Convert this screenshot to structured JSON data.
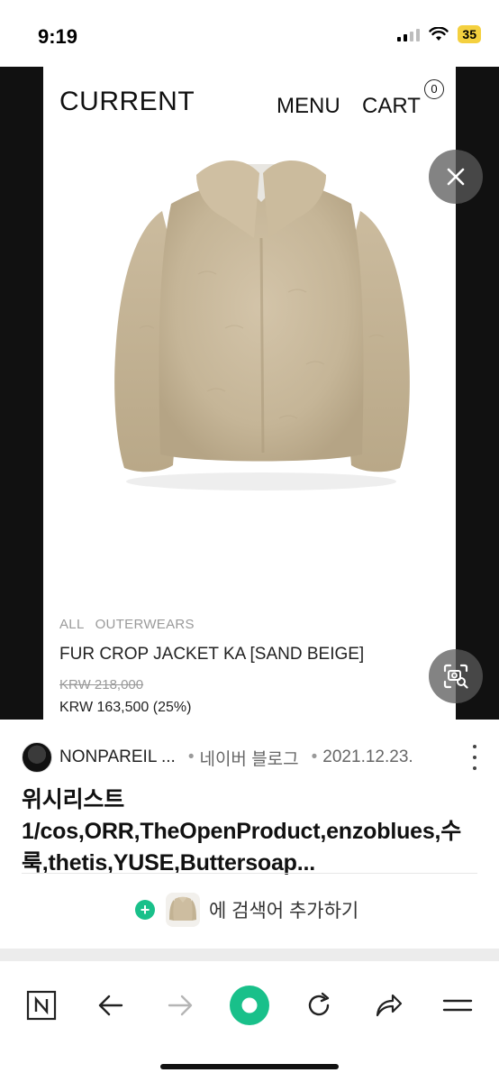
{
  "status_bar": {
    "time": "9:19",
    "battery": "35",
    "battery_color": "#f4d03f"
  },
  "viewer": {
    "site": {
      "brand": "CURRENT",
      "menu_label": "MENU",
      "cart_label": "CART",
      "cart_count": "0"
    },
    "product": {
      "breadcrumb": [
        "ALL",
        "OUTERWEARS"
      ],
      "name": "FUR CROP JACKET KA [SAND BEIGE]",
      "price_original": "KRW 218,000",
      "price_sale": "KRW 163,500 (25%)",
      "image_icon": "beige-fur-jacket"
    },
    "close_icon": "close-icon",
    "lens_icon": "image-search-icon"
  },
  "result": {
    "source_name": "NONPAREIL ...",
    "separator": "•",
    "source_type": "네이버 블로그",
    "date": "2021.12.23.",
    "title": "위시리스트1/cos,ORR,TheOpenProduct,enzoblues,수룩,thetis,YUSE,Buttersoap..."
  },
  "add_query": {
    "label": "에 검색어 추가하기",
    "accent": "#19c08a"
  },
  "toolbar": {
    "items": [
      "naver-home-icon",
      "back-arrow-icon",
      "forward-arrow-icon",
      "green-dot-icon",
      "refresh-icon",
      "share-icon",
      "menu-icon"
    ],
    "accent": "#19c08a"
  }
}
